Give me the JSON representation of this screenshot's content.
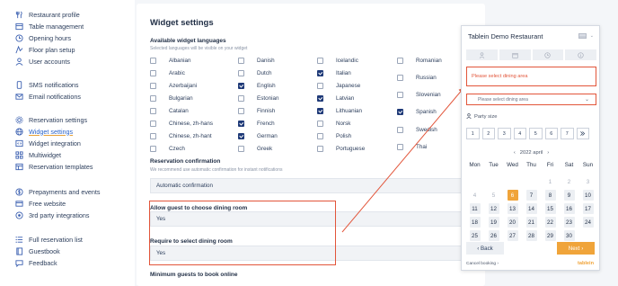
{
  "sidebar": {
    "items": [
      {
        "label": "Restaurant profile",
        "icon": "restaurant-icon"
      },
      {
        "label": "Table management",
        "icon": "table-icon"
      },
      {
        "label": "Opening hours",
        "icon": "clock-icon"
      },
      {
        "label": "Floor plan setup",
        "icon": "floor-plan-icon"
      },
      {
        "label": "User accounts",
        "icon": "user-icon"
      },
      {
        "label": "SMS notifications",
        "icon": "sms-icon"
      },
      {
        "label": "Email notifications",
        "icon": "email-icon"
      },
      {
        "label": "Reservation settings",
        "icon": "gear-icon"
      },
      {
        "label": "Widget settings",
        "icon": "globe-icon"
      },
      {
        "label": "Widget integration",
        "icon": "code-icon"
      },
      {
        "label": "Multiwidget",
        "icon": "grid-icon"
      },
      {
        "label": "Reservation templates",
        "icon": "template-icon"
      },
      {
        "label": "Prepayments and events",
        "icon": "dollar-icon"
      },
      {
        "label": "Free website",
        "icon": "website-icon"
      },
      {
        "label": "3rd party integrations",
        "icon": "integration-icon"
      },
      {
        "label": "Full reservation list",
        "icon": "list-icon"
      },
      {
        "label": "Guestbook",
        "icon": "book-icon"
      },
      {
        "label": "Feedback",
        "icon": "chat-icon"
      }
    ]
  },
  "panel": {
    "title": "Widget settings",
    "languages_title": "Available widget languages",
    "languages_subtitle": "Selected languages will be visible on your widget",
    "languages": [
      {
        "name": "Albanian",
        "checked": false
      },
      {
        "name": "Arabic",
        "checked": false
      },
      {
        "name": "Azerbaijani",
        "checked": false
      },
      {
        "name": "Bulgarian",
        "checked": false
      },
      {
        "name": "Catalan",
        "checked": false
      },
      {
        "name": "Chinese, zh-hans",
        "checked": false
      },
      {
        "name": "Chinese, zh-hant",
        "checked": false
      },
      {
        "name": "Czech",
        "checked": false
      },
      {
        "name": "Danish",
        "checked": false
      },
      {
        "name": "Dutch",
        "checked": false
      },
      {
        "name": "English",
        "checked": true
      },
      {
        "name": "Estonian",
        "checked": false
      },
      {
        "name": "Finnish",
        "checked": false
      },
      {
        "name": "French",
        "checked": true
      },
      {
        "name": "German",
        "checked": true
      },
      {
        "name": "Greek",
        "checked": false
      },
      {
        "name": "Icelandic",
        "checked": false
      },
      {
        "name": "Italian",
        "checked": true
      },
      {
        "name": "Japanese",
        "checked": false
      },
      {
        "name": "Latvian",
        "checked": true
      },
      {
        "name": "Lithuanian",
        "checked": true
      },
      {
        "name": "Norsk",
        "checked": false
      },
      {
        "name": "Polish",
        "checked": false
      },
      {
        "name": "Portuguese",
        "checked": false
      },
      {
        "name": "Romanian",
        "checked": false
      },
      {
        "name": "Russian",
        "checked": false
      },
      {
        "name": "Slovenian",
        "checked": false
      },
      {
        "name": "Spanish",
        "checked": true
      },
      {
        "name": "Swedish",
        "checked": false
      },
      {
        "name": "Thai",
        "checked": false
      }
    ],
    "confirmation_title": "Reservation confirmation",
    "confirmation_subtitle": "We recommend use automatic confirmation for instant notifications",
    "confirmation_value": "Automatic confirmation",
    "dining_room_title": "Allow guest to choose dining room",
    "dining_room_value": "Yes",
    "require_title": "Require to select dining room",
    "require_value": "Yes",
    "min_guests_title": "Minimum guests to book online"
  },
  "widget": {
    "title": "Tablein Demo Restaurant",
    "tab_icons": [
      "person-icon",
      "calendar-icon",
      "clock-icon",
      "info-icon"
    ],
    "error_text": "Please select dining area",
    "select_placeholder": "Please select dining area",
    "party_label": "Party size",
    "party_sizes": [
      "1",
      "2",
      "3",
      "4",
      "5",
      "6",
      "7"
    ],
    "month_label": "2022 april",
    "weekdays": [
      "Mon",
      "Tue",
      "Wed",
      "Thu",
      "Fri",
      "Sat",
      "Sun"
    ],
    "days": [
      {
        "d": "",
        "s": "empty"
      },
      {
        "d": "",
        "s": "empty"
      },
      {
        "d": "",
        "s": "empty"
      },
      {
        "d": "",
        "s": "empty"
      },
      {
        "d": "1",
        "s": "past"
      },
      {
        "d": "2",
        "s": "past"
      },
      {
        "d": "3",
        "s": "past"
      },
      {
        "d": "4",
        "s": "past"
      },
      {
        "d": "5",
        "s": "past"
      },
      {
        "d": "6",
        "s": "today"
      },
      {
        "d": "7",
        "s": "avail"
      },
      {
        "d": "8",
        "s": "avail"
      },
      {
        "d": "9",
        "s": "avail"
      },
      {
        "d": "10",
        "s": "avail"
      },
      {
        "d": "11",
        "s": "avail"
      },
      {
        "d": "12",
        "s": "avail"
      },
      {
        "d": "13",
        "s": "avail"
      },
      {
        "d": "14",
        "s": "avail"
      },
      {
        "d": "15",
        "s": "avail"
      },
      {
        "d": "16",
        "s": "avail"
      },
      {
        "d": "17",
        "s": "avail"
      },
      {
        "d": "18",
        "s": "avail"
      },
      {
        "d": "19",
        "s": "avail"
      },
      {
        "d": "20",
        "s": "avail"
      },
      {
        "d": "21",
        "s": "avail"
      },
      {
        "d": "22",
        "s": "avail"
      },
      {
        "d": "23",
        "s": "avail"
      },
      {
        "d": "24",
        "s": "avail"
      },
      {
        "d": "25",
        "s": "avail"
      },
      {
        "d": "26",
        "s": "avail"
      },
      {
        "d": "27",
        "s": "avail"
      },
      {
        "d": "28",
        "s": "avail"
      },
      {
        "d": "29",
        "s": "avail"
      },
      {
        "d": "30",
        "s": "avail"
      },
      {
        "d": "",
        "s": "empty"
      }
    ],
    "back_label": "Back",
    "next_label": "Next",
    "cancel_label": "Cancel booking",
    "brand": "tablein"
  },
  "colors": {
    "accent": "#f0a43a",
    "highlight": "#e2553a",
    "checkbox": "#1f3a78",
    "link": "#2a63c9"
  }
}
